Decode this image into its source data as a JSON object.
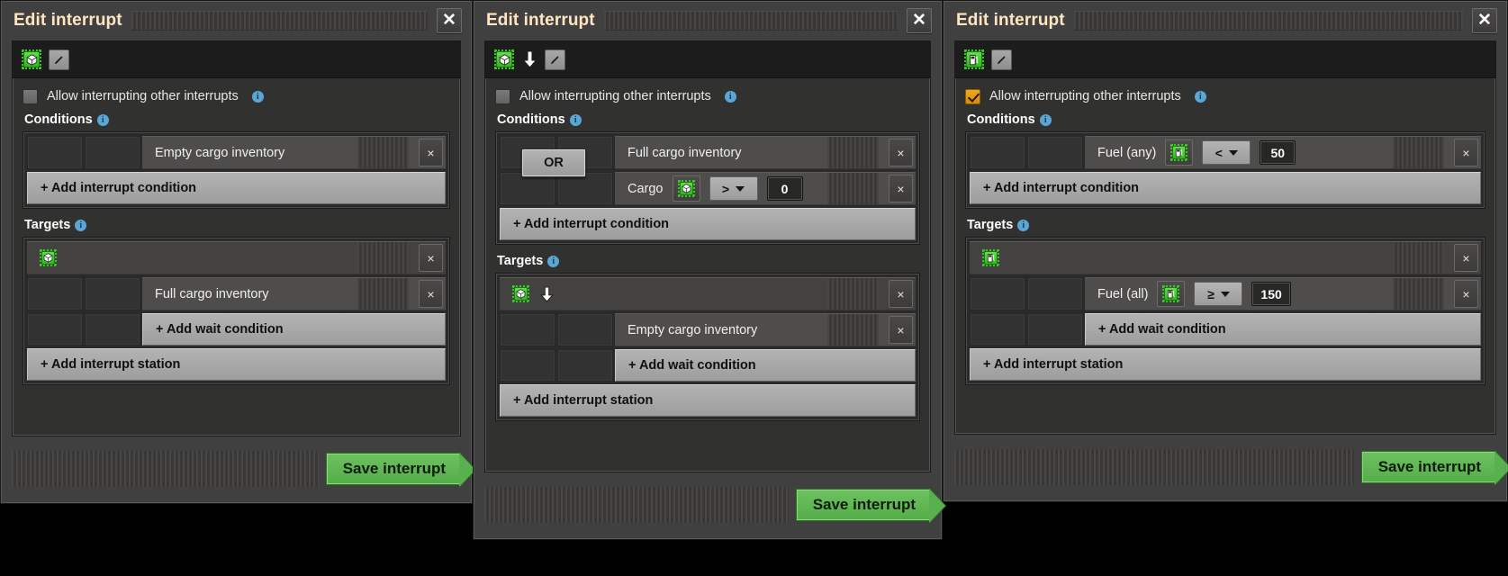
{
  "common": {
    "title": "Edit interrupt",
    "close_label": "✕",
    "allow_label": "Allow interrupting other interrupts",
    "conditions_label": "Conditions",
    "targets_label": "Targets",
    "add_interrupt_condition": "+ Add interrupt condition",
    "add_wait_condition": "+ Add wait condition",
    "add_interrupt_station": "+ Add interrupt station",
    "save_label": "Save interrupt",
    "info_glyph": "i",
    "remove_glyph": "×",
    "or_label": "OR",
    "colors": {
      "accent_green": "#5fb84e",
      "chip_green": "#3fc52c",
      "checkbox_orange": "#e89d12",
      "title_cream": "#ffe6c0",
      "info_blue": "#5aa7d6"
    }
  },
  "panels": [
    {
      "id": "panel-cargo-empty",
      "title": "Edit interrupt",
      "icons": [
        {
          "name": "cargo-chip-icon",
          "glyph": "cube"
        },
        {
          "name": "edit-pencil-icon",
          "glyph": "pencil"
        }
      ],
      "allow_interrupting": false,
      "conditions": [
        {
          "label": "Empty cargo inventory",
          "has_signal": false,
          "comparator": "",
          "value": ""
        }
      ],
      "condition_operator": "",
      "targets": [
        {
          "station_icons": [
            {
              "name": "cargo-chip-icon",
              "glyph": "cube"
            }
          ],
          "wait_conditions": [
            {
              "label": "Full cargo inventory",
              "has_signal": false,
              "comparator": "",
              "value": ""
            }
          ]
        }
      ]
    },
    {
      "id": "panel-cargo-full-or",
      "title": "Edit interrupt",
      "icons": [
        {
          "name": "cargo-chip-icon",
          "glyph": "cube"
        },
        {
          "name": "arrow-down-icon",
          "glyph": "arrow-down"
        },
        {
          "name": "edit-pencil-icon",
          "glyph": "pencil"
        }
      ],
      "allow_interrupting": false,
      "conditions": [
        {
          "label": "Full cargo inventory",
          "has_signal": false,
          "comparator": "",
          "value": ""
        },
        {
          "label": "Cargo",
          "has_signal": true,
          "signal": "cube",
          "comparator": ">",
          "value": "0"
        }
      ],
      "condition_operator": "OR",
      "targets": [
        {
          "station_icons": [
            {
              "name": "cargo-chip-icon",
              "glyph": "cube"
            },
            {
              "name": "arrow-down-icon",
              "glyph": "arrow-down"
            }
          ],
          "wait_conditions": [
            {
              "label": "Empty cargo inventory",
              "has_signal": false,
              "comparator": "",
              "value": ""
            }
          ]
        }
      ]
    },
    {
      "id": "panel-fuel",
      "title": "Edit interrupt",
      "icons": [
        {
          "name": "fuel-chip-icon",
          "glyph": "fuel"
        },
        {
          "name": "edit-pencil-icon",
          "glyph": "pencil"
        }
      ],
      "allow_interrupting": true,
      "conditions": [
        {
          "label": "Fuel (any)",
          "has_signal": true,
          "signal": "fuel",
          "comparator": "<",
          "value": "50"
        }
      ],
      "condition_operator": "",
      "targets": [
        {
          "station_icons": [
            {
              "name": "fuel-chip-icon",
              "glyph": "fuel"
            }
          ],
          "wait_conditions": [
            {
              "label": "Fuel (all)",
              "has_signal": true,
              "signal": "fuel",
              "comparator": "≥",
              "value": "150"
            }
          ]
        }
      ]
    }
  ]
}
